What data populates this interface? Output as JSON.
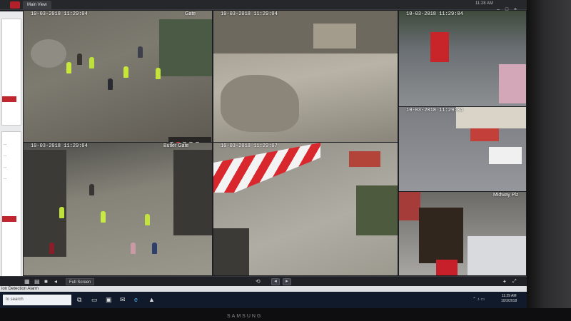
{
  "app": {
    "tab_label": "Main View",
    "top_time": "11:28 AM",
    "window_controls": [
      "minimize-icon",
      "maximize-icon",
      "close-icon"
    ]
  },
  "left_panel": {
    "items": [
      "...",
      "...",
      "...",
      "...",
      "..."
    ]
  },
  "cameras": [
    {
      "timestamp": "10-03-2018 11:29:04",
      "name": "Gate"
    },
    {
      "timestamp": "10-03-2018 11:29:04",
      "name": ""
    },
    {
      "timestamp": "10-03-2018 11:29:04",
      "name": ""
    },
    {
      "timestamp": "10-03-2018 11:29:04",
      "name": ""
    },
    {
      "timestamp": "10-03-2018 11:29:04",
      "name": "Butler Gate"
    },
    {
      "timestamp": "10-03-2018 11:29:07",
      "name": ""
    },
    {
      "timestamp": "",
      "name": "Midway Plz"
    }
  ],
  "playbar": {
    "fullscreen_label": "Full Screen",
    "prev_icon": "arrow-left-icon",
    "next_icon": "arrow-right-icon"
  },
  "alarm": {
    "text": "ion Detection Alarm"
  },
  "taskbar": {
    "search_placeholder": "to search",
    "time": "11:29 AM",
    "date": "10/3/2018"
  },
  "monitor": {
    "brand": "SAMSUNG"
  },
  "colors": {
    "accent_red": "#c0262d",
    "taskbar": "#101a2b",
    "playbar": "#202126"
  }
}
